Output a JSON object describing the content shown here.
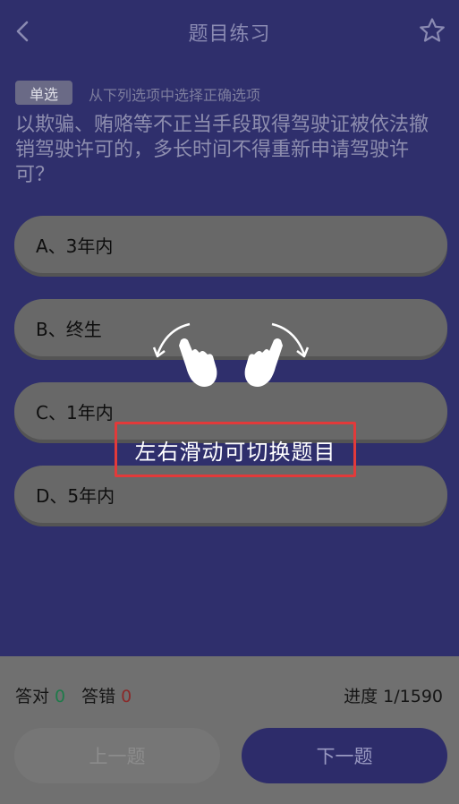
{
  "header": {
    "title": "题目练习"
  },
  "question": {
    "type_badge": "单选",
    "hint": "从下列选项中选择正确选项",
    "text": "以欺骗、贿赂等不正当手段取得驾驶证被依法撤销驾驶许可的，多长时间不得重新申请驾驶许可？"
  },
  "options": [
    {
      "label": "A、3年内"
    },
    {
      "label": "B、终生"
    },
    {
      "label": "C、1年内"
    },
    {
      "label": "D、5年内"
    }
  ],
  "overlay": {
    "toast": "左右滑动可切换题目"
  },
  "footer": {
    "correct_label": "答对",
    "correct_count": "0",
    "wrong_label": "答错",
    "wrong_count": "0",
    "progress_label": "进度",
    "progress_value": "1/1590",
    "prev_label": "上一题",
    "next_label": "下一题"
  },
  "colors": {
    "background": "#2f2f6c",
    "toast_border": "#e23a3a",
    "correct": "#1f7a4a",
    "wrong": "#8a2a2a"
  },
  "icons": [
    "back-icon",
    "star-icon",
    "swipe-left-hand-icon",
    "swipe-right-hand-icon"
  ]
}
